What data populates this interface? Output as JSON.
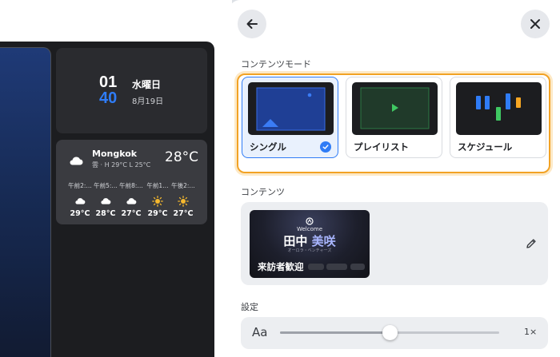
{
  "preview": {
    "clock": {
      "hour": "01",
      "minute": "40",
      "weekday": "水曜日",
      "date": "8月19日"
    },
    "weather": {
      "city": "Mongkok",
      "summary": "雲 · H 29°C L 25°C",
      "temp": "28°C",
      "forecast": [
        {
          "time": "午前2:…",
          "icon": "cloud-icon",
          "temp": "29°C"
        },
        {
          "time": "午前5:…",
          "icon": "cloud-icon",
          "temp": "28°C"
        },
        {
          "time": "午前8:…",
          "icon": "cloud-icon",
          "temp": "27°C"
        },
        {
          "time": "午前1…",
          "icon": "sun-icon",
          "temp": "29°C"
        },
        {
          "time": "午後2:…",
          "icon": "sun-icon",
          "temp": "27°C"
        }
      ]
    }
  },
  "panel": {
    "back_icon": "arrow-left-icon",
    "close_icon": "close-icon",
    "content_mode_label": "コンテンツモード",
    "modes": [
      {
        "label": "シングル",
        "selected": true
      },
      {
        "label": "プレイリスト",
        "selected": false
      },
      {
        "label": "スケジュール",
        "selected": false
      }
    ],
    "content_label": "コンテンツ",
    "content_item": {
      "welcome": "Welcome",
      "family_name": "田中",
      "given_name": "美咲",
      "kana": "オーロラ・ベンチャーズ",
      "caption": "来訪者歓迎",
      "edit_icon": "pencil-icon"
    },
    "settings_label": "設定",
    "font_size": {
      "glyph": "Aa",
      "scale": "1×",
      "level": 0.5
    }
  },
  "colors": {
    "accent": "#2f7cf6",
    "highlight": "#f2a224"
  }
}
